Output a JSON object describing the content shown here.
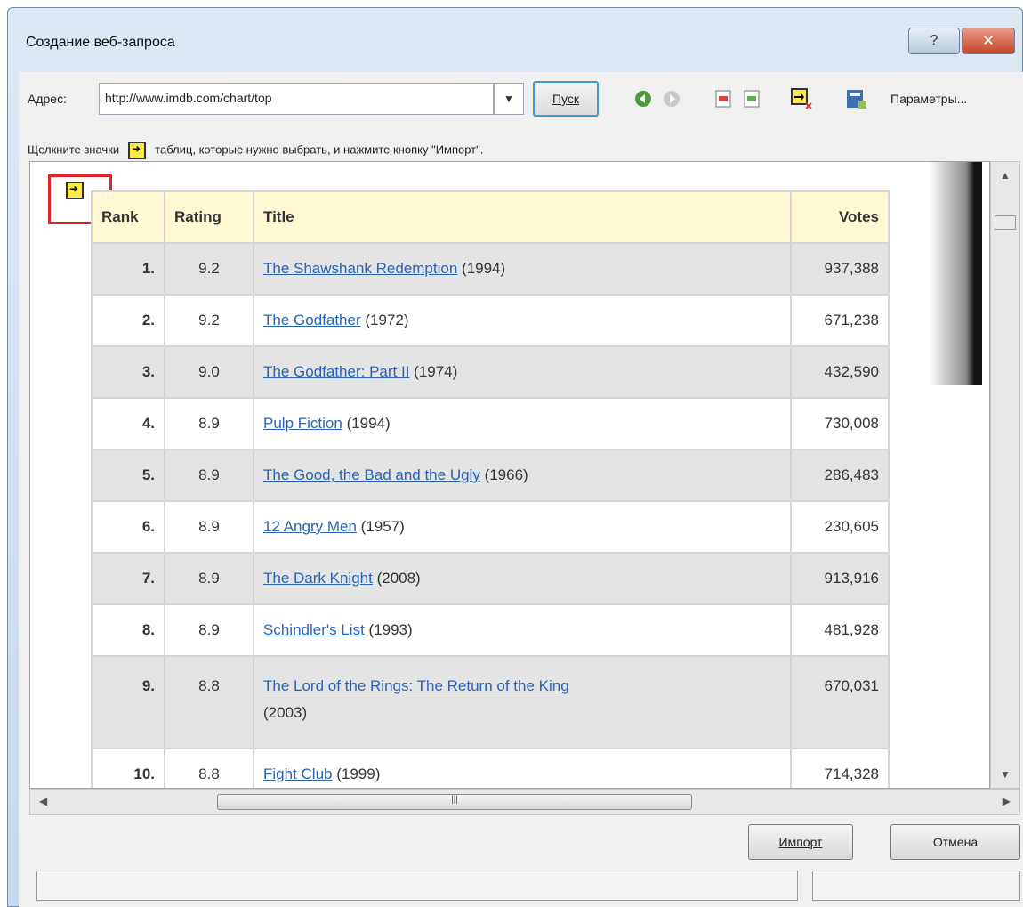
{
  "window": {
    "title": "Создание веб-запроса",
    "help_label": "?",
    "close_label": "✕"
  },
  "toolbar": {
    "address_label": "Адрес:",
    "address_value": "http://www.imdb.com/chart/top",
    "go_label": "Пуск",
    "params_label": "Параметры..."
  },
  "hint": {
    "before": "Щелкните значки",
    "after": "таблиц, которые нужно выбрать, и нажмите кнопку \"Импорт\"."
  },
  "table": {
    "headers": [
      "Rank",
      "Rating",
      "Title",
      "Votes"
    ],
    "rows": [
      {
        "rank": "1.",
        "rating": "9.2",
        "title": "The Shawshank Redemption",
        "year": "(1994)",
        "votes": "937,388"
      },
      {
        "rank": "2.",
        "rating": "9.2",
        "title": "The Godfather",
        "year": "(1972)",
        "votes": "671,238"
      },
      {
        "rank": "3.",
        "rating": "9.0",
        "title": "The Godfather: Part II",
        "year": "(1974)",
        "votes": "432,590"
      },
      {
        "rank": "4.",
        "rating": "8.9",
        "title": "Pulp Fiction",
        "year": "(1994)",
        "votes": "730,008"
      },
      {
        "rank": "5.",
        "rating": "8.9",
        "title": "The Good, the Bad and the Ugly",
        "year": "(1966)",
        "votes": "286,483"
      },
      {
        "rank": "6.",
        "rating": "8.9",
        "title": "12 Angry Men",
        "year": "(1957)",
        "votes": "230,605"
      },
      {
        "rank": "7.",
        "rating": "8.9",
        "title": "The Dark Knight",
        "year": "(2008)",
        "votes": "913,916"
      },
      {
        "rank": "8.",
        "rating": "8.9",
        "title": "Schindler's List",
        "year": "(1993)",
        "votes": "481,928"
      },
      {
        "rank": "9.",
        "rating": "8.8",
        "title": "The Lord of the Rings: The Return of the King",
        "year": "(2003)",
        "votes": "670,031"
      },
      {
        "rank": "10.",
        "rating": "8.8",
        "title": "Fight Club",
        "year": "(1999)",
        "votes": "714,328"
      }
    ]
  },
  "buttons": {
    "import_label": "Импорт",
    "cancel_label": "Отмена"
  },
  "colors": {
    "accent": "#3c9ad6",
    "highlight": "#e0242b",
    "link": "#2a63b5",
    "header_bg": "#fff8d2"
  }
}
